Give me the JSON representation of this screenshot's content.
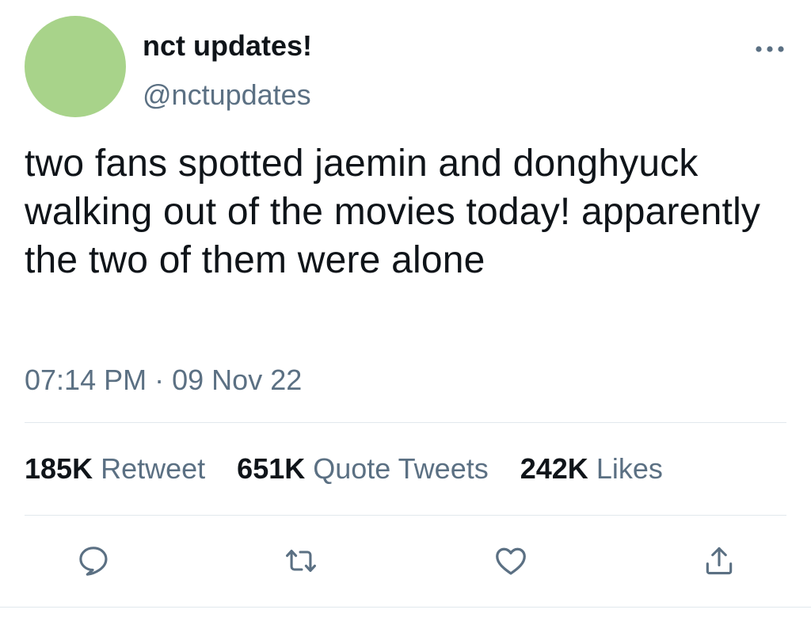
{
  "user": {
    "display_name": "nct updates!",
    "handle": "@nctupdates",
    "avatar_color": "#a8d38a"
  },
  "tweet": {
    "text": "two fans spotted jaemin and donghyuck walking out of the movies today! apparently the two of them were alone",
    "time": "07:14 PM",
    "separator": "·",
    "date": "09 Nov 22"
  },
  "stats": {
    "retweets": {
      "count": "185K",
      "label": "Retweet"
    },
    "quotes": {
      "count": "651K",
      "label": "Quote Tweets"
    },
    "likes": {
      "count": "242K",
      "label": "Likes"
    }
  },
  "actions": [
    "reply-icon",
    "retweet-icon",
    "like-icon",
    "share-icon"
  ],
  "colors": {
    "text": "#0f1419",
    "secondary": "#5b7083",
    "divider": "#e1e8ed"
  }
}
